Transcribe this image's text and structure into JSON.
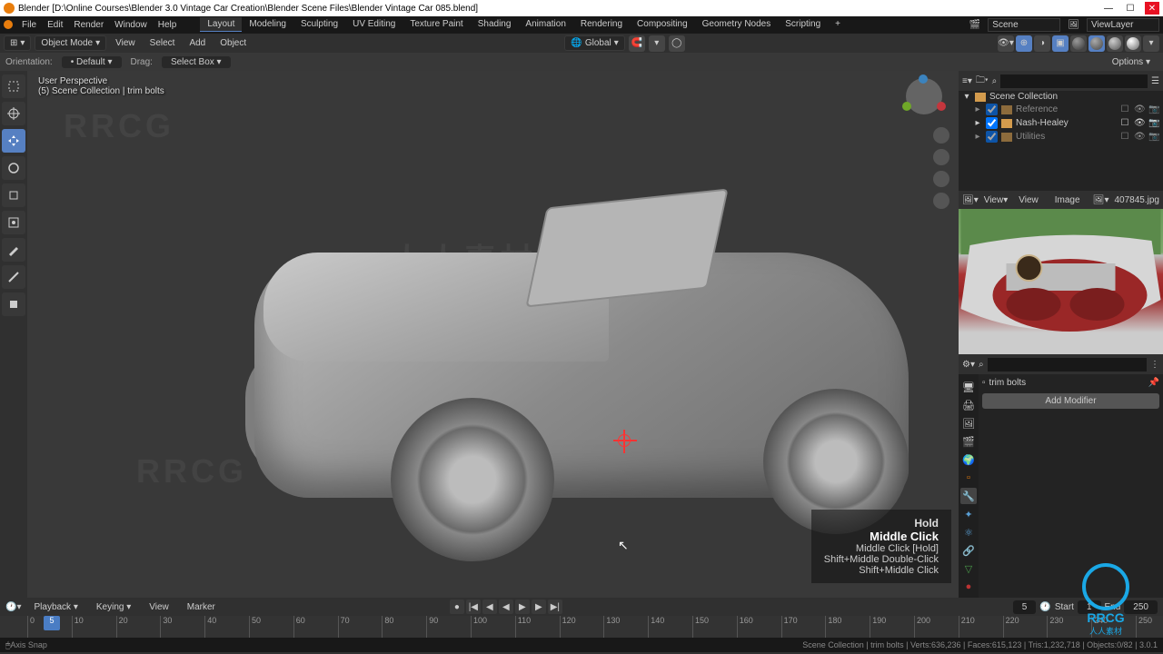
{
  "window": {
    "title": "Blender [D:\\Online Courses\\Blender 3.0 Vintage Car Creation\\Blender Scene Files\\Blender Vintage Car 085.blend]"
  },
  "menu": {
    "items": [
      "File",
      "Edit",
      "Render",
      "Window",
      "Help"
    ],
    "workspaces": [
      "Layout",
      "Modeling",
      "Sculpting",
      "UV Editing",
      "Texture Paint",
      "Shading",
      "Animation",
      "Rendering",
      "Compositing",
      "Geometry Nodes",
      "Scripting"
    ],
    "active_workspace": "Layout",
    "scene_label": "Scene",
    "viewlayer_label": "ViewLayer"
  },
  "header": {
    "mode": "Object Mode",
    "view": "View",
    "select": "Select",
    "add": "Add",
    "object": "Object",
    "transform_orient": "Global"
  },
  "second_header": {
    "orientation_label": "Orientation:",
    "orientation_value": "Default",
    "drag_label": "Drag:",
    "drag_value": "Select Box",
    "options": "Options"
  },
  "viewport": {
    "line1": "User Perspective",
    "line2": "(5) Scene Collection | trim bolts"
  },
  "key_overlay": {
    "hold": "Hold",
    "main": "Middle Click",
    "l1": "Middle Click [Hold]",
    "l2": "Shift+Middle Double-Click",
    "l3": "Shift+Middle Click"
  },
  "outliner": {
    "root": "Scene Collection",
    "items": [
      {
        "name": "Reference",
        "muted": true
      },
      {
        "name": "Nash-Healey",
        "muted": false
      },
      {
        "name": "Utilities",
        "muted": true
      }
    ]
  },
  "image_editor": {
    "view_label": "View",
    "view_menu": "View",
    "image_menu": "Image",
    "image_name": "407845.jpg"
  },
  "properties": {
    "object_name": "trim bolts",
    "add_modifier": "Add Modifier",
    "search_placeholder": ""
  },
  "timeline": {
    "playback": "Playback",
    "keying": "Keying",
    "view": "View",
    "marker": "Marker",
    "current": 5,
    "start_label": "Start",
    "start": 1,
    "end_label": "End",
    "end": 250,
    "ticks": [
      0,
      10,
      20,
      30,
      40,
      50,
      60,
      70,
      80,
      90,
      100,
      110,
      120,
      130,
      140,
      150,
      160,
      170,
      180,
      190,
      200,
      210,
      220,
      230,
      240,
      250
    ]
  },
  "status": {
    "left": "Axis Snap",
    "right": "Scene Collection | trim bolts | Verts:636,236 | Faces:615,123 | Tris:1,232,718 | Objects:0/82 | 3.0.1"
  },
  "icons": {
    "caret": "▾",
    "search": "⌕",
    "eye": "👁",
    "camera": "📷",
    "check": "✓",
    "play": "▶",
    "pause": "❚❚",
    "prev": "◀",
    "first": "|◀",
    "next": "▶",
    "last": "▶|",
    "rec": "●"
  },
  "rrcg": {
    "text": "RRCG",
    "sub": "人人素材"
  }
}
